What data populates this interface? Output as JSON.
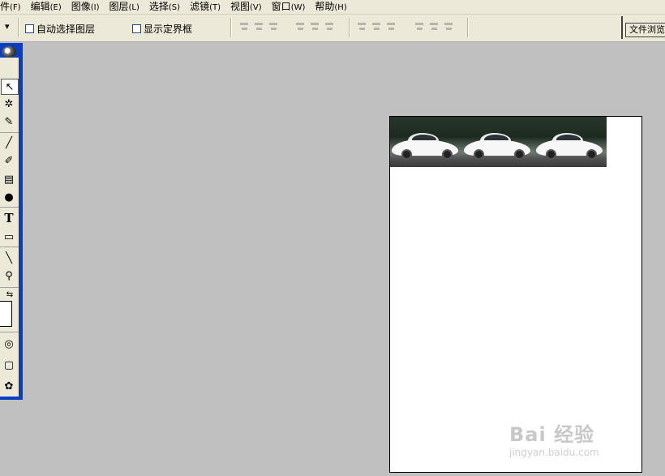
{
  "menubar": {
    "items": [
      {
        "label": "件",
        "accel": "(F)"
      },
      {
        "label": "编辑",
        "accel": "(E)"
      },
      {
        "label": "图像",
        "accel": "(I)"
      },
      {
        "label": "图层",
        "accel": "(L)"
      },
      {
        "label": "选择",
        "accel": "(S)"
      },
      {
        "label": "滤镜",
        "accel": "(T)"
      },
      {
        "label": "视图",
        "accel": "(V)"
      },
      {
        "label": "窗口",
        "accel": "(W)"
      },
      {
        "label": "帮助",
        "accel": "(H)"
      }
    ]
  },
  "options": {
    "tool_arrow": "▾",
    "auto_select_layer": "自动选择图层",
    "show_bounding_box": "显示定界框",
    "file_browser": "文件浏览"
  },
  "toolbox": {
    "tools": [
      {
        "name": "move-tool-icon",
        "glyph": "↖"
      },
      {
        "name": "magic-wand-icon",
        "glyph": "✲"
      },
      {
        "name": "healing-brush-icon",
        "glyph": "✎"
      },
      {
        "name": "brush-icon",
        "glyph": "╱"
      },
      {
        "name": "history-brush-icon",
        "glyph": "✐"
      },
      {
        "name": "gradient-icon",
        "glyph": "▤"
      },
      {
        "name": "dodge-icon",
        "glyph": "●"
      },
      {
        "name": "type-tool-icon",
        "glyph": "T"
      },
      {
        "name": "rectangle-shape-icon",
        "glyph": "▭"
      },
      {
        "name": "eyedropper-icon",
        "glyph": "╲"
      },
      {
        "name": "zoom-icon",
        "glyph": "⚲"
      },
      {
        "name": "swap-colors-icon",
        "glyph": "⇆"
      },
      {
        "name": "quick-mask-icon",
        "glyph": "◎"
      },
      {
        "name": "screen-mode-icon",
        "glyph": "▢"
      },
      {
        "name": "imageready-icon",
        "glyph": "✿"
      }
    ]
  },
  "watermark": {
    "brand": "Bai 经验",
    "url": "jingyan.baidu.com"
  }
}
